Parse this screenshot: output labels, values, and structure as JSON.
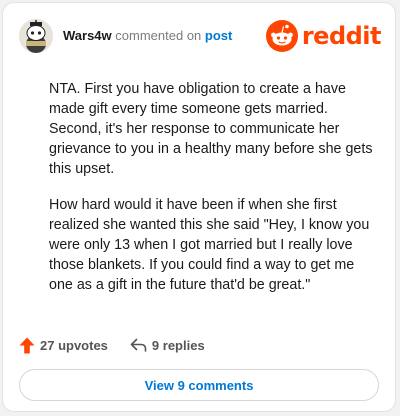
{
  "comment": {
    "username": "Wars4w",
    "commented_on_text": "commented on",
    "post_link_text": "post",
    "paragraphs": [
      "NTA. First you have obligation to create a have made gift every time someone gets married. Second, it's her response to communicate her grievance to you in a healthy many before she gets this upset.",
      "How hard would it have been if when she first realized she wanted this she said \"Hey, I know you were only 13 when I got married but I really love those blankets. If you could find a way to get me one as a gift in the future that'd be great.\""
    ]
  },
  "brand": {
    "wordmark": "reddit",
    "color": "#ff4500"
  },
  "actions": {
    "upvotes_label": "27 upvotes",
    "replies_label": "9 replies",
    "upvote_icon": "upvote-arrow-icon",
    "reply_icon": "reply-arrow-icon"
  },
  "footer": {
    "view_comments_label": "View 9 comments"
  },
  "colors": {
    "link": "#0079d3",
    "text": "#1a1a1b",
    "muted": "#7c7c7c",
    "accent": "#ff4500"
  }
}
